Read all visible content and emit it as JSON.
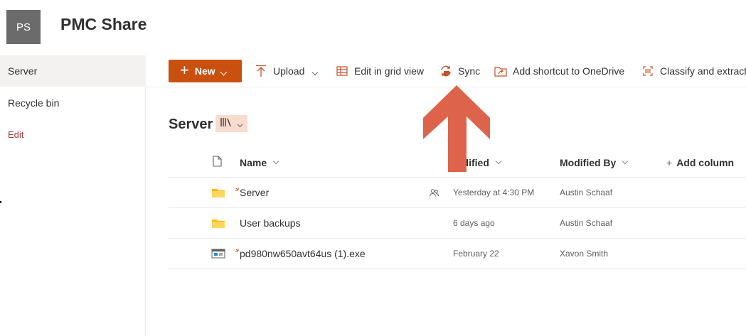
{
  "site": {
    "logo_initials": "PS",
    "title": "PMC Share"
  },
  "nav": {
    "items": [
      {
        "label": "Server",
        "selected": true
      },
      {
        "label": "Recycle bin",
        "selected": false
      }
    ],
    "edit_label": "Edit"
  },
  "toolbar": {
    "new_label": "New",
    "upload_label": "Upload",
    "grid_label": "Edit in grid view",
    "sync_label": "Sync",
    "shortcut_label": "Add shortcut to OneDrive",
    "classify_label": "Classify and extract"
  },
  "library": {
    "title": "Server",
    "view_icon": "library-view-icon"
  },
  "columns": {
    "name": "Name",
    "modified": "odified",
    "modified_by": "Modified By",
    "add_column": "Add column"
  },
  "files": [
    {
      "name": "Server",
      "type": "folder",
      "is_new": true,
      "shared": true,
      "modified": "Yesterday at 4:30 PM",
      "modified_by": "Austin Schaaf"
    },
    {
      "name": "User backups",
      "type": "folder",
      "is_new": false,
      "shared": false,
      "modified": "6 days ago",
      "modified_by": "Austin Schaaf"
    },
    {
      "name": "pd980nw650avt64us (1).exe",
      "type": "exe",
      "is_new": true,
      "shared": false,
      "modified": "February 22",
      "modified_by": "Xavon Smith"
    }
  ],
  "colors": {
    "accent": "#ca5010",
    "overlay_arrow": "#dd644a",
    "edit_link": "#a4373a",
    "folder": "#ffb900"
  }
}
